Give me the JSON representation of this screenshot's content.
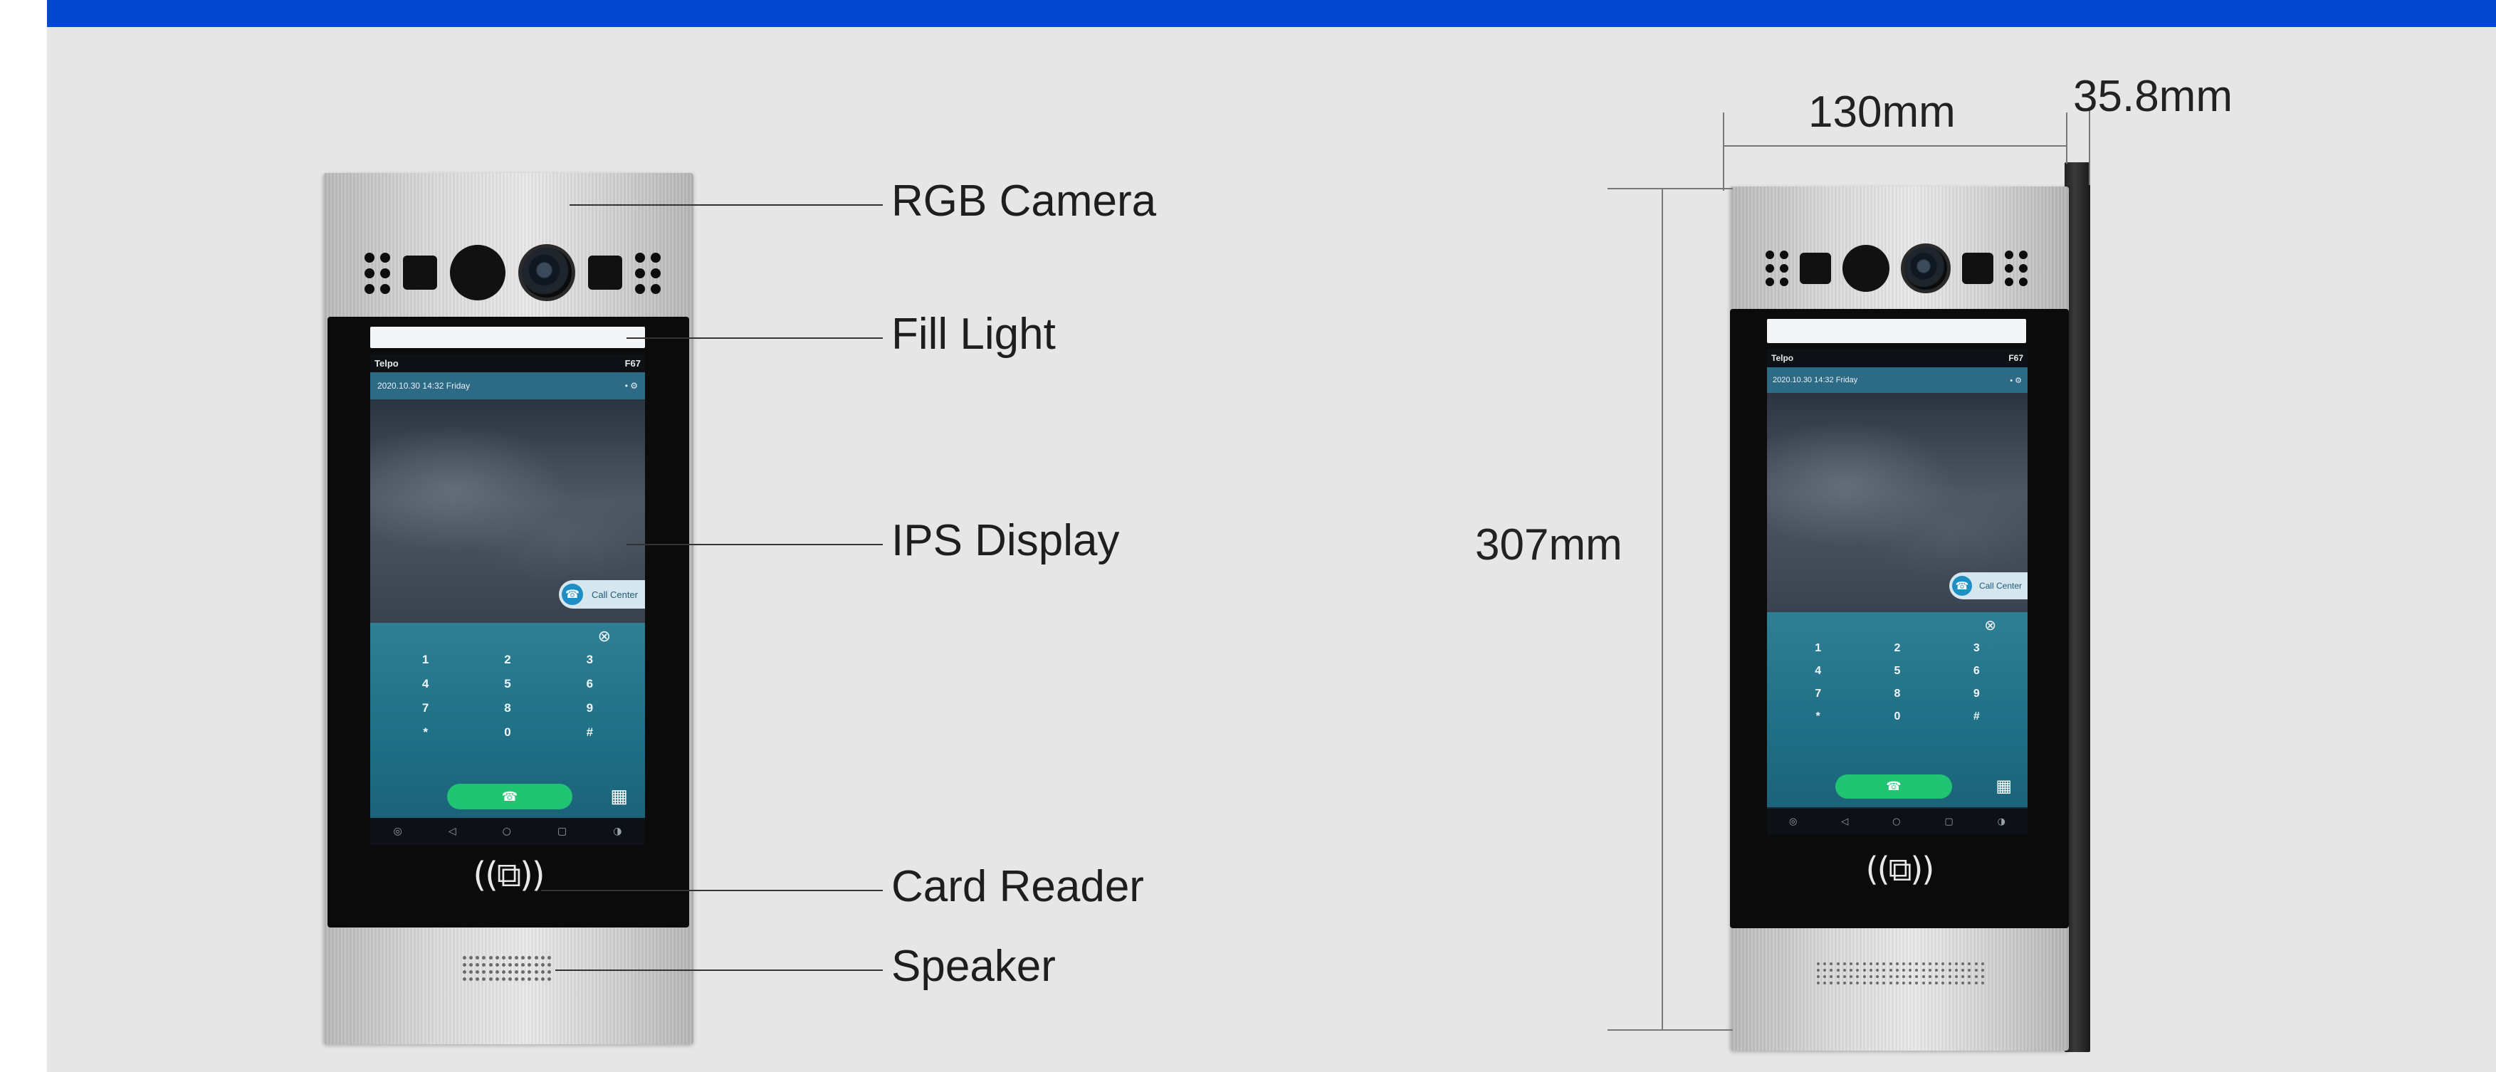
{
  "colors": {
    "top_bar": "#0349d0",
    "background": "#e6e6e6",
    "call_button": "#20c473",
    "keypad": "#1f6f86"
  },
  "labels": {
    "rgb_camera": "RGB Camera",
    "fill_light": "Fill Light",
    "ips_display": "IPS Display",
    "card_reader": "Card Reader",
    "speaker": "Speaker"
  },
  "dimensions": {
    "width": "130mm",
    "depth": "35.8mm",
    "height": "307mm"
  },
  "screen": {
    "brand": "Telpo",
    "model": "F67",
    "datetime": "2020.10.30 14:32 Friday",
    "call_center": "Call Center",
    "keys": [
      "1",
      "2",
      "3",
      "4",
      "5",
      "6",
      "7",
      "8",
      "9",
      "*",
      "0",
      "#"
    ],
    "clear_icon": "⊗",
    "dialpad_icon": "▦",
    "phone_icon": "☎",
    "nav_icons": [
      "◎",
      "◁",
      "○",
      "▢",
      "◑"
    ]
  },
  "card_reader_symbol": "((⧉))"
}
